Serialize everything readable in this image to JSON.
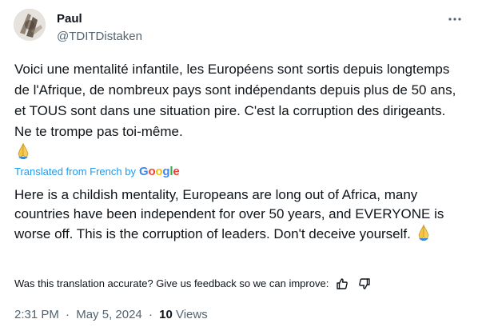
{
  "author": {
    "name": "Paul",
    "handle": "@TDITDistaken"
  },
  "tweet": {
    "original_text": "Voici une mentalité infantile, les Européens sont sortis depuis longtemps de l'Afrique, de nombreux pays sont indépendants depuis plus de 50 ans, et TOUS sont dans une situation pire. C'est la corruption des dirigeants. Ne te trompe pas toi-même.",
    "translated_from": "Translated from French by",
    "translator": "Google",
    "translation_text": "Here is a childish mentality, Europeans are long out of Africa, many countries have been independent for over 50 years, and EVERYONE is worse off. This is the corruption of leaders. Don't deceive yourself."
  },
  "feedback": {
    "prompt": "Was this translation accurate? Give us feedback so we can improve:"
  },
  "meta": {
    "time": "2:31 PM",
    "date": "May 5, 2024",
    "separator": "·",
    "views_count": "10",
    "views_label": "Views"
  },
  "icons": {
    "more": "more-dots-icon",
    "pray": "folded-hands-emoji",
    "thumbs_up": "thumbs-up-icon",
    "thumbs_down": "thumbs-down-icon"
  },
  "colors": {
    "text": "#0f1419",
    "secondary": "#536471",
    "accent": "#1d9bf0"
  }
}
